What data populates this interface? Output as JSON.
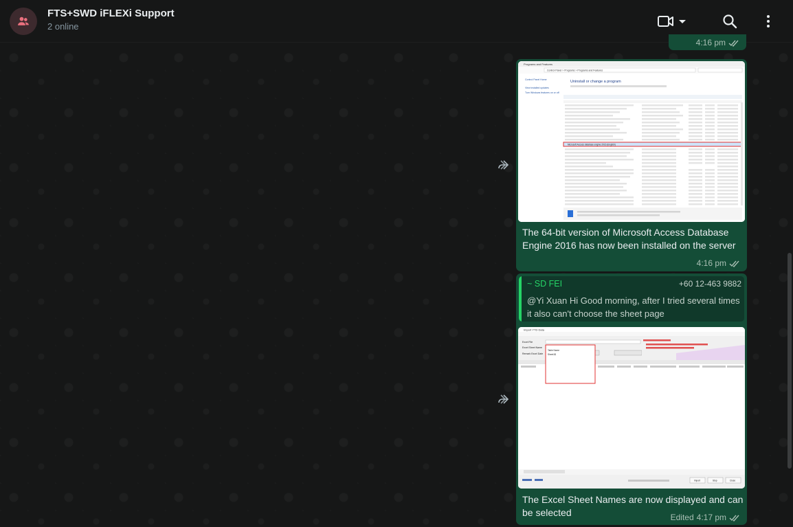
{
  "header": {
    "title": "FTS+SWD iFLEXi Support",
    "subtitle": "2 online"
  },
  "messages": [
    {
      "time": "4:16 pm"
    },
    {
      "caption": "The 64-bit version of Microsoft Access Database Engine 2016 has now been installed on the server",
      "time": "4:16 pm",
      "image": {
        "window_title": "Programs and Features",
        "breadcrumb": "Control Panel > Programs > Programs and Features",
        "heading": "Uninstall or change a program",
        "sidebar": [
          "Control Panel Home",
          "View installed updates",
          "Turn Windows features on or off"
        ],
        "highlighted_row": "Microsoft Access database engine 2016 (English)"
      }
    },
    {
      "quote": {
        "name": "~ SD FEI",
        "phone": "+60 12-463 9882",
        "text": "@Yi Xuan Hi Good morning, after I tried several times it also can't choose the sheet page"
      },
      "caption": "The Excel Sheet Names are now displayed and can be selected",
      "edited_label": "Edited",
      "time": "4:17 pm",
      "image": {
        "window_title": "Import YTD Data",
        "fields": [
          "Excel File",
          "Excel Sheet Name",
          "Remark Excel Date"
        ],
        "popup_header": "Table Name",
        "popup_item": "Sheet1$",
        "buttons": [
          "Import",
          "Stop",
          "Close"
        ]
      }
    }
  ],
  "colors": {
    "bubble_out": "#144d37",
    "accent_green": "#25d366",
    "header_bg": "#161717"
  }
}
